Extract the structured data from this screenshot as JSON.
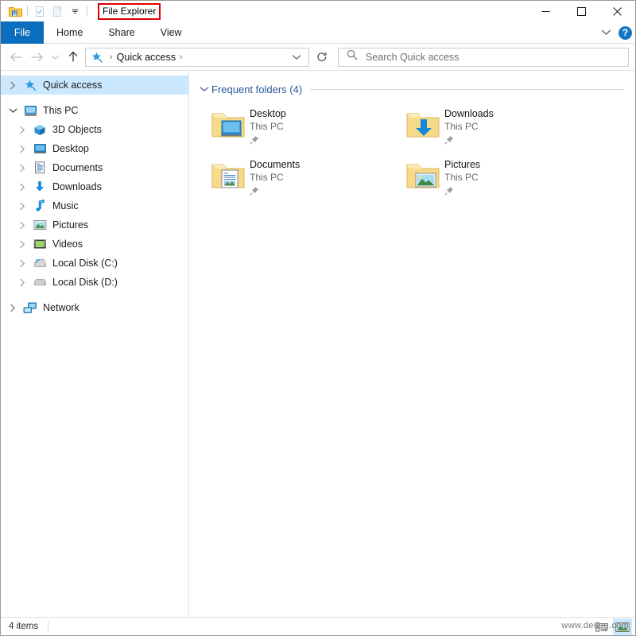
{
  "window": {
    "title": "File Explorer",
    "quick_access_toolbar": [
      {
        "name": "explorer-folder-icon",
        "label": "File Explorer"
      },
      {
        "name": "properties-icon",
        "label": "Properties"
      },
      {
        "name": "new-folder-icon",
        "label": "New folder"
      },
      {
        "name": "customize-chevron-icon",
        "label": "Customize Quick Access Toolbar"
      }
    ],
    "controls": {
      "minimize": "Minimize",
      "maximize": "Maximize",
      "close": "Close"
    },
    "title_highlight_color": "#e00000"
  },
  "ribbon": {
    "tabs": [
      {
        "label": "File",
        "active": true
      },
      {
        "label": "Home",
        "active": false
      },
      {
        "label": "Share",
        "active": false
      },
      {
        "label": "View",
        "active": false
      }
    ],
    "expand_label": "Expand the Ribbon",
    "help_label": "?",
    "accent_color": "#0b6ebd"
  },
  "navigation": {
    "back_label": "Back",
    "forward_label": "Forward",
    "recent_label": "Recent locations",
    "up_label": "Up",
    "refresh_label": "Refresh",
    "breadcrumb": {
      "icon": "quick-access-star-icon",
      "path": "Quick access",
      "separator": "›"
    },
    "address_chevron_label": "Previous locations"
  },
  "search": {
    "placeholder": "Search Quick access",
    "value": "",
    "icon": "search-icon"
  },
  "sidebar": {
    "items": [
      {
        "label": "Quick access",
        "icon": "quick-access-star-icon",
        "level": 0,
        "expanded": false,
        "selected": true,
        "has_twisty": true
      },
      {
        "label": "This PC",
        "icon": "this-pc-icon",
        "level": 0,
        "expanded": true,
        "selected": false,
        "has_twisty": true
      },
      {
        "label": "3D Objects",
        "icon": "3d-objects-icon",
        "level": 1,
        "expanded": false,
        "selected": false,
        "has_twisty": true
      },
      {
        "label": "Desktop",
        "icon": "desktop-icon",
        "level": 1,
        "expanded": false,
        "selected": false,
        "has_twisty": true
      },
      {
        "label": "Documents",
        "icon": "documents-icon",
        "level": 1,
        "expanded": false,
        "selected": false,
        "has_twisty": true
      },
      {
        "label": "Downloads",
        "icon": "downloads-icon",
        "level": 1,
        "expanded": false,
        "selected": false,
        "has_twisty": true
      },
      {
        "label": "Music",
        "icon": "music-icon",
        "level": 1,
        "expanded": false,
        "selected": false,
        "has_twisty": true
      },
      {
        "label": "Pictures",
        "icon": "pictures-icon",
        "level": 1,
        "expanded": false,
        "selected": false,
        "has_twisty": true
      },
      {
        "label": "Videos",
        "icon": "videos-icon",
        "level": 1,
        "expanded": false,
        "selected": false,
        "has_twisty": true
      },
      {
        "label": "Local Disk (C:)",
        "icon": "local-disk-c-icon",
        "level": 1,
        "expanded": false,
        "selected": false,
        "has_twisty": true
      },
      {
        "label": "Local Disk (D:)",
        "icon": "local-disk-d-icon",
        "level": 1,
        "expanded": false,
        "selected": false,
        "has_twisty": true
      },
      {
        "label": "Network",
        "icon": "network-icon",
        "level": 0,
        "expanded": false,
        "selected": false,
        "has_twisty": true
      }
    ],
    "selection_color": "#cce8ff"
  },
  "content": {
    "group": {
      "title": "Frequent folders (4)",
      "expanded": true,
      "title_color": "#2b5797"
    },
    "tiles": [
      {
        "name": "Desktop",
        "subtitle": "This PC",
        "icon": "folder-desktop-icon",
        "pinned": true
      },
      {
        "name": "Downloads",
        "subtitle": "This PC",
        "icon": "folder-downloads-icon",
        "pinned": true
      },
      {
        "name": "Documents",
        "subtitle": "This PC",
        "icon": "folder-documents-icon",
        "pinned": true
      },
      {
        "name": "Pictures",
        "subtitle": "This PC",
        "icon": "folder-pictures-icon",
        "pinned": true
      }
    ]
  },
  "statusbar": {
    "item_count": "4 items",
    "view_buttons": [
      {
        "name": "details-view-button",
        "label": "Details view",
        "active": false
      },
      {
        "name": "large-icons-view-button",
        "label": "Large icons view",
        "active": true
      }
    ],
    "watermark": "www.deuag.com"
  }
}
